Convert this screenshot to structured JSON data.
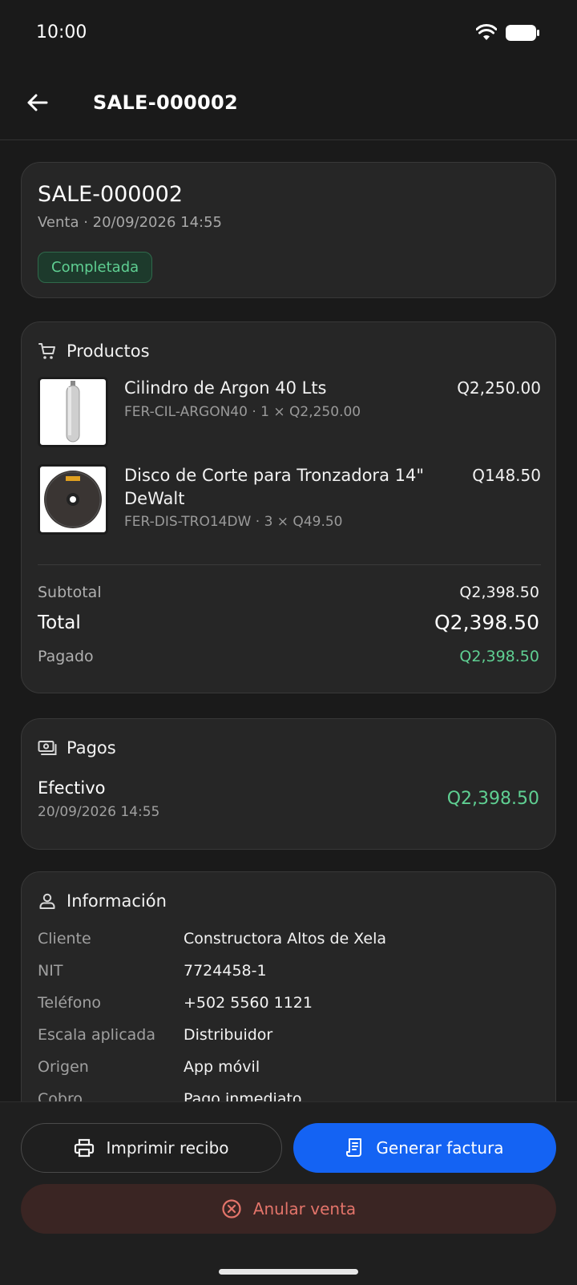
{
  "status_bar": {
    "time": "10:00"
  },
  "app_bar": {
    "title": "SALE-000002"
  },
  "summary": {
    "sale_id": "SALE-000002",
    "subtitle": "Venta · 20/09/2026 14:55",
    "status": "Completada"
  },
  "products": {
    "header": "Productos",
    "items": [
      {
        "name": "Cilindro de Argon 40 Lts",
        "meta": "FER-CIL-ARGON40 · 1 × Q2,250.00",
        "price": "Q2,250.00"
      },
      {
        "name": "Disco de Corte para Tronzadora 14\" DeWalt",
        "meta": "FER-DIS-TRO14DW · 3 × Q49.50",
        "price": "Q148.50"
      }
    ],
    "subtotal_label": "Subtotal",
    "subtotal_value": "Q2,398.50",
    "total_label": "Total",
    "total_value": "Q2,398.50",
    "paid_label": "Pagado",
    "paid_value": "Q2,398.50"
  },
  "payments": {
    "header": "Pagos",
    "method": "Efectivo",
    "date": "20/09/2026 14:55",
    "amount": "Q2,398.50"
  },
  "info": {
    "header": "Información",
    "rows": [
      {
        "label": "Cliente",
        "value": "Constructora Altos de Xela"
      },
      {
        "label": "NIT",
        "value": "7724458-1"
      },
      {
        "label": "Teléfono",
        "value": "+502 5560 1121"
      },
      {
        "label": "Escala aplicada",
        "value": "Distribuidor"
      },
      {
        "label": "Origen",
        "value": "App móvil"
      },
      {
        "label": "Cobro",
        "value": "Pago inmediato"
      }
    ]
  },
  "actions": {
    "print_label": "Imprimir recibo",
    "invoice_label": "Generar factura",
    "void_label": "Anular venta"
  },
  "colors": {
    "accent": "#1463f3",
    "success": "#5fcf92",
    "danger": "#e3746a"
  }
}
